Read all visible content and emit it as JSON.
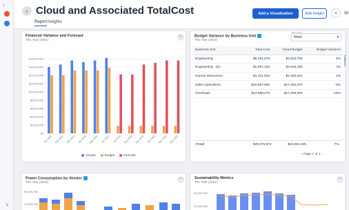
{
  "header": {
    "title": "Cloud and Associated TotalCost",
    "tabs": [
      "Report",
      "Insights"
    ],
    "add_visualization": "Add a Visualization",
    "add_insight": "Add Insight"
  },
  "colors": {
    "actuals": "#4f81e8",
    "budget": "#f0a347",
    "forecast": "#e05260",
    "primary": "#1f5fd0"
  },
  "financial_card": {
    "title": "Financial Variance and Forecast",
    "subtitle": "This Year (2022)",
    "legend": [
      "Actuals",
      "Budget",
      "Forecast"
    ]
  },
  "chart_data": [
    {
      "type": "bar",
      "title": "Financial Variance and Forecast",
      "categories": [
        "Jan 2022",
        "Feb 2022",
        "Mar 2022",
        "Apr 2022",
        "May 2022",
        "Jun 2022",
        "Jul 2022",
        "Aug 2022",
        "Sep 2022",
        "Oct 2022",
        "Nov 2022",
        "Dec 2022"
      ],
      "ylim": [
        0,
        20000000
      ],
      "ytick_labels": [
        "$0",
        "$2,000,000",
        "$4,000,000",
        "$6,000,000",
        "$8,000,000",
        "$10,000,000",
        "$12,000,000",
        "$14,000,000",
        "$16,000,000",
        "$18,000,000"
      ],
      "series": [
        {
          "name": "Actuals",
          "values": [
            16000000,
            16600000,
            17600000,
            17200000,
            17600000,
            18200000,
            0,
            0,
            0,
            0,
            0,
            0
          ]
        },
        {
          "name": "Budget",
          "values": [
            14000000,
            14000000,
            15200000,
            15200000,
            15200000,
            15800000,
            1800000,
            1800000,
            1800000,
            1800000,
            1800000,
            1800000
          ]
        },
        {
          "name": "Forecast",
          "values": [
            0,
            0,
            0,
            0,
            0,
            0,
            14200000,
            14200000,
            16600000,
            17000000,
            17600000,
            17600000
          ]
        }
      ],
      "grid": true,
      "legend": "bottom"
    }
  ],
  "budget_card": {
    "title": "Budget Variance by Business Unit",
    "subtitle": "This Year (2022)",
    "pivot_label": "Pivot By",
    "pivot_value": "None",
    "columns": [
      "Business Unit",
      "Total Cost",
      "Cloud Budget",
      "Budget Variance"
    ],
    "rows": [
      [
        "Engineering",
        "$5,181,679",
        "$4,942,768",
        "5%"
      ],
      [
        "Engineering - QA",
        "$2,097,423",
        "$2,048,156",
        "2%"
      ],
      [
        "Human Resources",
        "$1,431,634",
        "$1,403,024",
        "2%"
      ],
      [
        "Sales Operations",
        "$16,567,965",
        "$17,404,074",
        "-5%"
      ],
      [
        "Overhead",
        "$14,998,270",
        "$17,293,303",
        "-15%"
      ]
    ],
    "total": [
      "(Total)",
      "$40,276,972",
      "$43,091,325",
      "-7%"
    ],
    "pager": "Page 1 of 1",
    "side_tab": "Columns"
  },
  "power_card": {
    "title": "Power Consumption by Vendor",
    "subtitle": "This Year (2022)",
    "ytick": "80,000,000",
    "ytick2": "70,000,000"
  },
  "sustain_card": {
    "title": "Sustainability Metrics",
    "subtitle": "This Year (2022)",
    "ytick": "15,000,000",
    "ytick2": "10,000,000"
  }
}
